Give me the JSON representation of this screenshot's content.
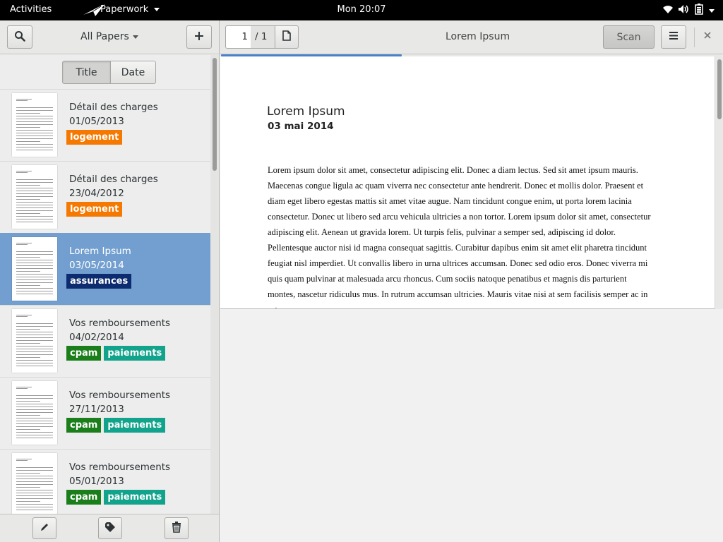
{
  "topbar": {
    "activities": "Activities",
    "app_name": "Paperwork",
    "clock": "Mon 20:07",
    "tray_icons": [
      "wifi-icon",
      "volume-icon",
      "battery-icon"
    ]
  },
  "sidebar": {
    "filter_label": "All Papers",
    "sort": {
      "title_label": "Title",
      "date_label": "Date",
      "active": "Title"
    },
    "documents": [
      {
        "title": "Détail des charges",
        "date": "01/05/2013",
        "tags": [
          {
            "label": "logement",
            "color": "#f57900"
          }
        ],
        "selected": false
      },
      {
        "title": "Détail des charges",
        "date": "23/04/2012",
        "tags": [
          {
            "label": "logement",
            "color": "#f57900"
          }
        ],
        "selected": false
      },
      {
        "title": "Lorem Ipsum",
        "date": "03/05/2014",
        "tags": [
          {
            "label": "assurances",
            "color": "#0d2b6f"
          }
        ],
        "selected": true
      },
      {
        "title": "Vos remboursements",
        "date": "04/02/2014",
        "tags": [
          {
            "label": "cpam",
            "color": "#1a7f1a"
          },
          {
            "label": "paiements",
            "color": "#11a38b"
          }
        ],
        "selected": false
      },
      {
        "title": "Vos remboursements",
        "date": "27/11/2013",
        "tags": [
          {
            "label": "cpam",
            "color": "#1a7f1a"
          },
          {
            "label": "paiements",
            "color": "#11a38b"
          }
        ],
        "selected": false
      },
      {
        "title": "Vos remboursements",
        "date": "05/01/2013",
        "tags": [
          {
            "label": "cpam",
            "color": "#1a7f1a"
          },
          {
            "label": "paiements",
            "color": "#11a38b"
          }
        ],
        "selected": false
      }
    ]
  },
  "viewer": {
    "page_current": "1",
    "page_total": "/ 1",
    "header_title": "Lorem Ipsum",
    "scan_label": "Scan",
    "progress_fraction": 0.36,
    "document": {
      "title": "Lorem Ipsum",
      "date": "03 mai 2014",
      "body": "Lorem ipsum dolor sit amet, consectetur adipiscing elit. Donec a diam lectus. Sed sit amet ipsum mauris. Maecenas congue ligula ac quam viverra nec consectetur ante hendrerit. Donec et mollis dolor. Praesent et diam eget libero egestas mattis sit amet vitae augue. Nam tincidunt congue enim, ut porta lorem lacinia consectetur. Donec ut libero sed arcu vehicula ultricies a non tortor. Lorem ipsum dolor sit amet, consectetur adipiscing elit. Aenean ut gravida lorem. Ut turpis felis, pulvinar a semper sed, adipiscing id dolor. Pellentesque auctor nisi id magna consequat sagittis. Curabitur dapibus enim sit amet elit pharetra tincidunt feugiat nisl imperdiet. Ut convallis libero in urna ultrices accumsan. Donec sed odio eros. Donec viverra mi quis quam pulvinar at malesuada arcu rhoncus. Cum sociis natoque penatibus et magnis dis parturient montes, nascetur ridiculus mus. In rutrum accumsan ultricies. Mauris vitae nisi at sem facilisis semper ac in est."
    }
  }
}
